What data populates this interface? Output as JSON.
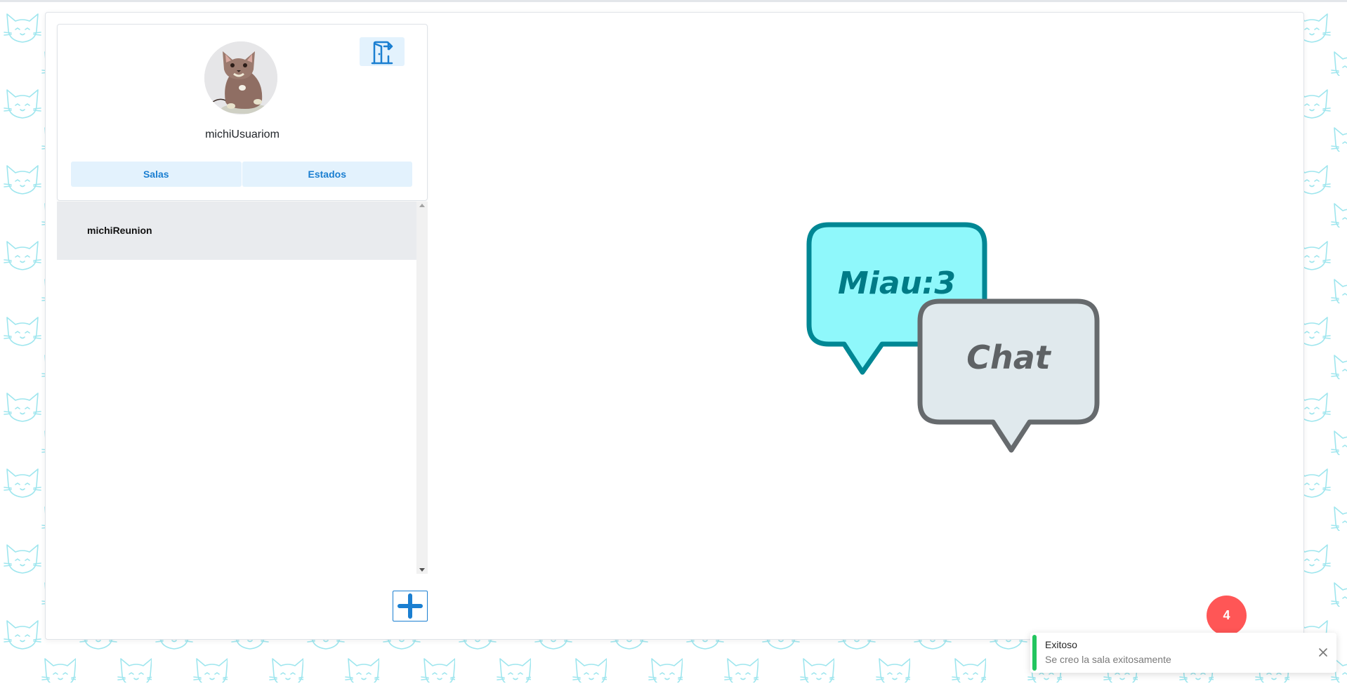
{
  "user": {
    "username": "michiUsuariom",
    "avatar": "cat-avatar"
  },
  "header": {
    "logout_icon": "door-exit-icon"
  },
  "tabs": [
    {
      "label": "Salas"
    },
    {
      "label": "Estados"
    }
  ],
  "rooms": [
    {
      "name": "michiReunion"
    }
  ],
  "add_room": {
    "icon": "plus-icon"
  },
  "logo": {
    "bubble_primary_text": "Miau:3",
    "bubble_secondary_text": "Chat"
  },
  "notification_badge": {
    "count": "4"
  },
  "toast": {
    "title": "Exitoso",
    "message": "Se creo la sala exitosamente"
  },
  "colors": {
    "accent": "#1b7fd1",
    "tab_background": "#e3f2fd",
    "room_selected": "#e9ebee",
    "bubble_primary_fill": "#8ff8fb",
    "bubble_primary_stroke": "#008794",
    "bubble_secondary_fill": "#e0e9ed",
    "bubble_secondary_stroke": "#666a6d",
    "badge": "#ff5656",
    "success": "#22c55e",
    "pattern": "#9fe6ee"
  }
}
